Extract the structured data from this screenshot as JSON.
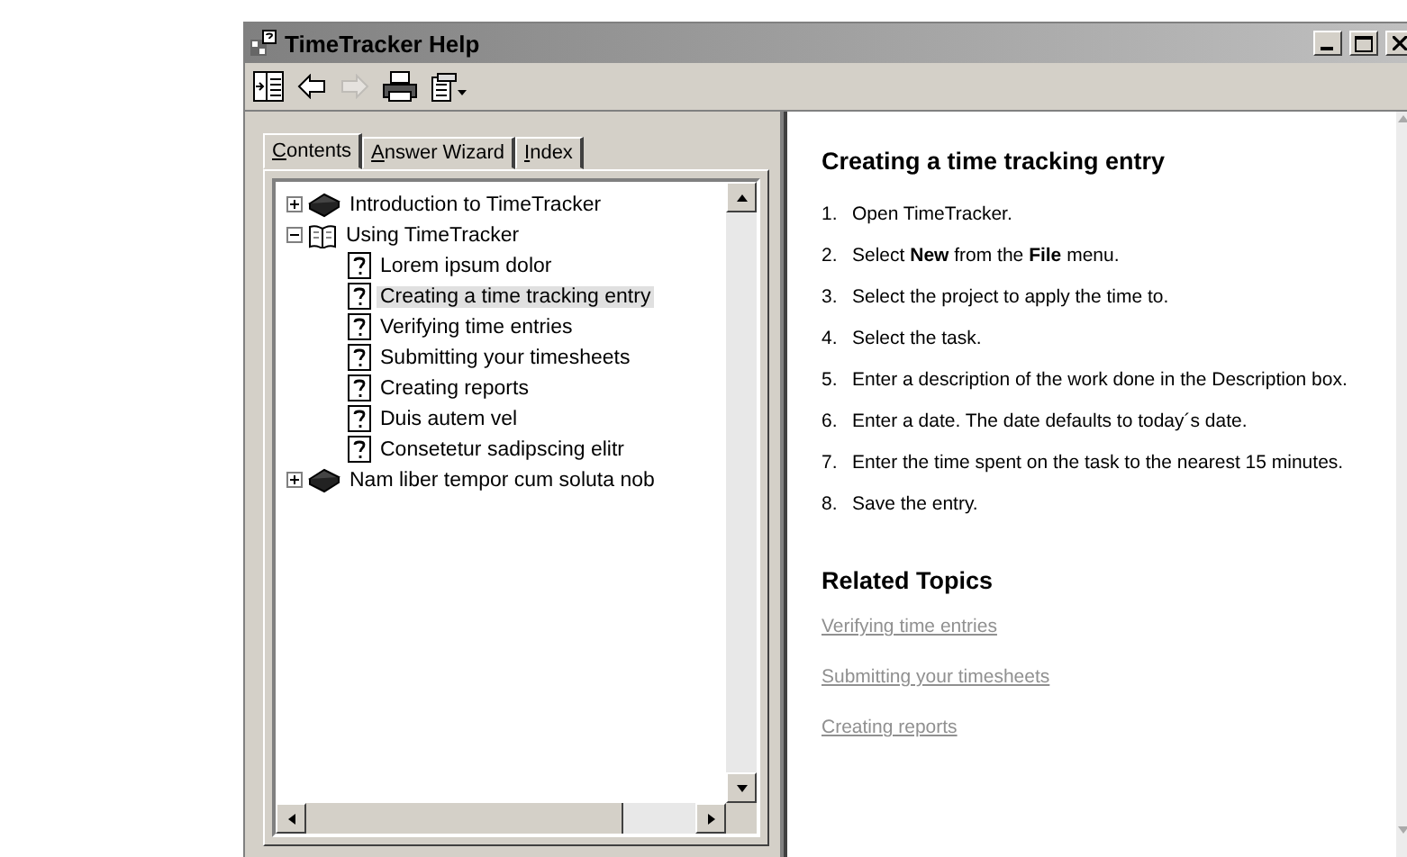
{
  "window": {
    "title": "TimeTracker Help"
  },
  "toolbar": [
    {
      "kind": "hide",
      "disabled": false
    },
    {
      "kind": "back",
      "disabled": false
    },
    {
      "kind": "forward",
      "disabled": true
    },
    {
      "kind": "print",
      "disabled": false
    },
    {
      "kind": "options",
      "disabled": false
    }
  ],
  "tabs": [
    {
      "label": "Contents",
      "selected": true
    },
    {
      "label": "Answer Wizard",
      "selected": false
    },
    {
      "label": "Index",
      "selected": false
    }
  ],
  "tree": [
    {
      "label": "Introduction to TimeTracker",
      "kind": "book",
      "expanded": false,
      "selected": false
    },
    {
      "label": "Using TimeTracker",
      "kind": "book",
      "expanded": true,
      "selected": false,
      "children": [
        {
          "label": "Lorem ipsum dolor",
          "kind": "page",
          "selected": false
        },
        {
          "label": "Creating a time tracking entry",
          "kind": "page",
          "selected": true
        },
        {
          "label": "Verifying time entries",
          "kind": "page",
          "selected": false
        },
        {
          "label": "Submitting your timesheets",
          "kind": "page",
          "selected": false
        },
        {
          "label": "Creating reports",
          "kind": "page",
          "selected": false
        },
        {
          "label": "Duis autem vel",
          "kind": "page",
          "selected": false
        },
        {
          "label": "Consetetur sadipscing elitr",
          "kind": "page",
          "selected": false
        }
      ]
    },
    {
      "label": "Nam liber tempor cum soluta nob",
      "kind": "book",
      "expanded": false,
      "selected": false
    }
  ],
  "topic": {
    "title": "Creating a time tracking entry",
    "steps": [
      {
        "number": "1.",
        "text": "Open TimeTracker."
      },
      {
        "number": "2.",
        "text": "Select **New** from the **File** menu."
      },
      {
        "number": "3.",
        "text": "Select the project to apply the time to."
      },
      {
        "number": "4.",
        "text": "Select the task."
      },
      {
        "number": "5.",
        "text": "Enter a description of the work done in the Description box."
      },
      {
        "number": "6.",
        "text": "Enter a date. The date defaults to today´s date."
      },
      {
        "number": "7.",
        "text": "Enter the time spent on the task to the nearest 15 minutes."
      },
      {
        "number": "8.",
        "text": "Save the entry."
      }
    ],
    "related_title": "Related Topics",
    "related": [
      "Verifying time entries",
      "Submitting your timesheets",
      "Creating reports"
    ]
  }
}
